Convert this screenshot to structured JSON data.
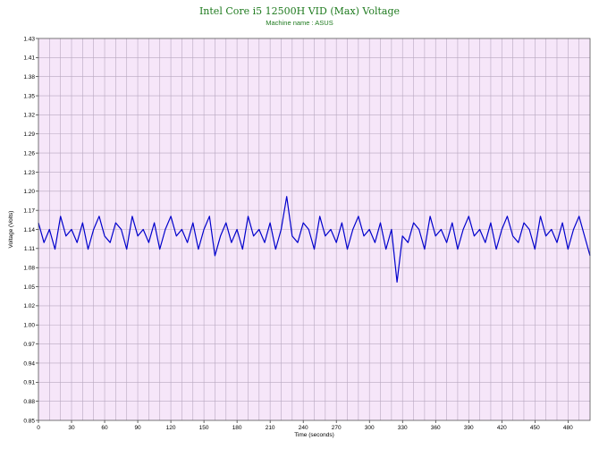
{
  "chart_data": {
    "type": "line",
    "title": "Intel Core i5 12500H VID (Max) Voltage",
    "subtitle": "Machine name : ASUS",
    "xlabel": "Time (seconds)",
    "ylabel": "Voltage (Volts)",
    "xlim": [
      0,
      500
    ],
    "ylim": [
      0.85,
      1.43
    ],
    "x_ticks": [
      0,
      30,
      60,
      90,
      120,
      150,
      180,
      210,
      240,
      270,
      300,
      330,
      360,
      390,
      420,
      450,
      480
    ],
    "y_ticks": [
      "0.85",
      "0.88",
      "0.91",
      "0.94",
      "0.97",
      "1.00",
      "1.02",
      "1.05",
      "1.08",
      "1.11",
      "1.14",
      "1.17",
      "1.20",
      "1.23",
      "1.26",
      "1.29",
      "1.32",
      "1.35",
      "1.38",
      "1.41",
      "1.43"
    ],
    "grid": true,
    "background_color": "#f6e6f9",
    "grid_color": "#b8a8c0",
    "line_color": "#0000cc",
    "series": [
      {
        "x": [
          0,
          5,
          10,
          15,
          20,
          25,
          30,
          35,
          40,
          45,
          50,
          55,
          60,
          65,
          70,
          75,
          80,
          85,
          90,
          95,
          100,
          105,
          110,
          115,
          120,
          125,
          130,
          135,
          140,
          145,
          150,
          155,
          160,
          165,
          170,
          175,
          180,
          185,
          190,
          195,
          200,
          205,
          210,
          215,
          220,
          225,
          230,
          235,
          240,
          245,
          250,
          255,
          260,
          265,
          270,
          275,
          280,
          285,
          290,
          295,
          300,
          305,
          310,
          315,
          320,
          325,
          330,
          335,
          340,
          345,
          350,
          355,
          360,
          365,
          370,
          375,
          380,
          385,
          390,
          395,
          400,
          405,
          410,
          415,
          420,
          425,
          430,
          435,
          440,
          445,
          450,
          455,
          460,
          465,
          470,
          475,
          480,
          485,
          490,
          495,
          500
        ],
        "values": [
          1.15,
          1.12,
          1.14,
          1.11,
          1.16,
          1.13,
          1.14,
          1.12,
          1.15,
          1.11,
          1.14,
          1.16,
          1.13,
          1.12,
          1.15,
          1.14,
          1.11,
          1.16,
          1.13,
          1.14,
          1.12,
          1.15,
          1.11,
          1.14,
          1.16,
          1.13,
          1.14,
          1.12,
          1.15,
          1.11,
          1.14,
          1.16,
          1.1,
          1.13,
          1.15,
          1.12,
          1.14,
          1.11,
          1.16,
          1.13,
          1.14,
          1.12,
          1.15,
          1.11,
          1.14,
          1.19,
          1.13,
          1.12,
          1.15,
          1.14,
          1.11,
          1.16,
          1.13,
          1.14,
          1.12,
          1.15,
          1.11,
          1.14,
          1.16,
          1.13,
          1.14,
          1.12,
          1.15,
          1.11,
          1.14,
          1.06,
          1.13,
          1.12,
          1.15,
          1.14,
          1.11,
          1.16,
          1.13,
          1.14,
          1.12,
          1.15,
          1.11,
          1.14,
          1.16,
          1.13,
          1.14,
          1.12,
          1.15,
          1.11,
          1.14,
          1.16,
          1.13,
          1.12,
          1.15,
          1.14,
          1.11,
          1.16,
          1.13,
          1.14,
          1.12,
          1.15,
          1.11,
          1.14,
          1.16,
          1.13,
          1.1
        ]
      }
    ]
  }
}
